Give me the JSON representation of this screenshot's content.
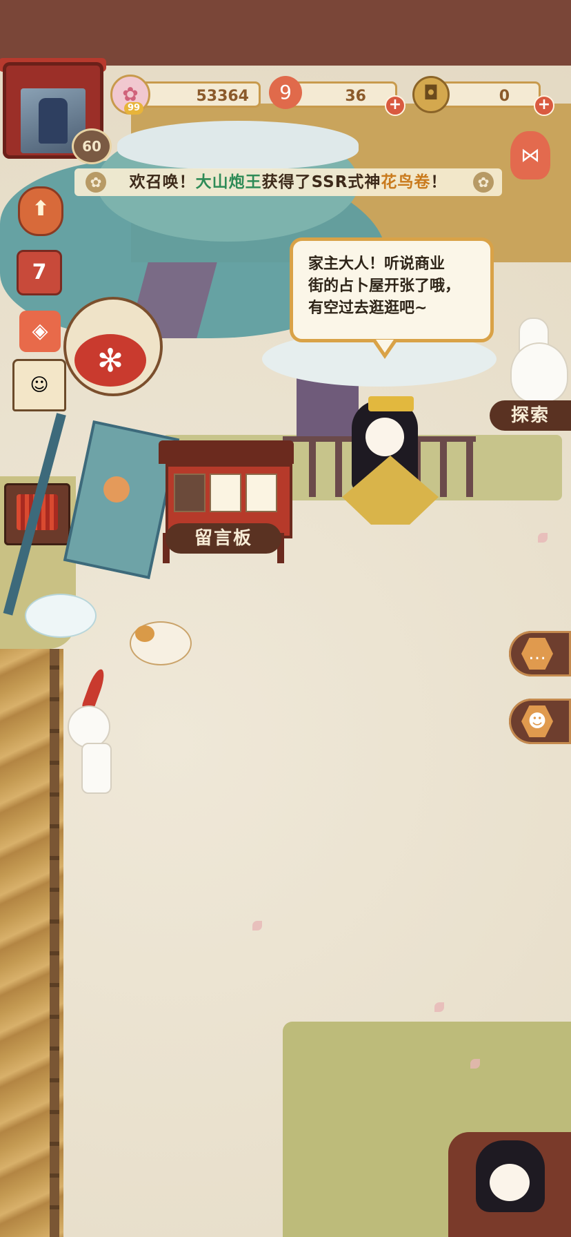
{
  "hud": {
    "player_level": "60",
    "sakura_currency": "53364",
    "sakura_badge": "99",
    "stamina": "36",
    "coins": "0",
    "stamina_icon_text": "9"
  },
  "announcement": {
    "prefix": "欢召唤！",
    "player_name": "大山炮王",
    "middle": "获得了SSR式神",
    "shikigami": "花鸟卷",
    "suffix": "！"
  },
  "dialog": {
    "text_line1": "家主大人！听说商业",
    "text_line2": "街的占卜屋开张了哦，",
    "text_line3": "有空过去逛逛吧~"
  },
  "buildings": {
    "message_board_label": "留言板",
    "explore_label": "探索",
    "calendar_day": "7"
  },
  "colors": {
    "accent_brown": "#5a3222",
    "highlight_green": "#2e8b57",
    "highlight_orange": "#c97a1c"
  },
  "icons": {
    "sakura": "sakura-icon",
    "stamina": "stamina-icon",
    "coin": "coin-icon",
    "chat": "chat-icon",
    "shikigami": "shikigami-icon"
  }
}
